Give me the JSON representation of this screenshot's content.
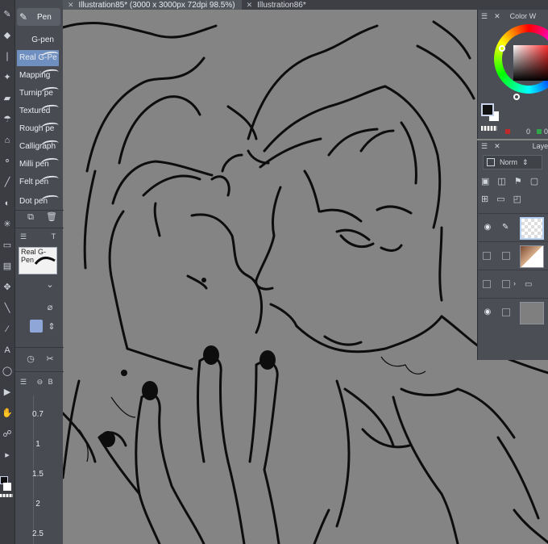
{
  "tabs": [
    {
      "label": "Illustration85* (3000 x 3000px 72dpi 98.5%)",
      "active": true
    },
    {
      "label": "Illustration86*",
      "active": false
    }
  ],
  "subtool": {
    "group_label": "Pen",
    "brushes": [
      {
        "label": "G-pen",
        "selected": false
      },
      {
        "label": "Real G-Pe",
        "selected": true
      },
      {
        "label": "Mapping",
        "selected": false
      },
      {
        "label": "Turnip pe",
        "selected": false
      },
      {
        "label": "Textured",
        "selected": false
      },
      {
        "label": "Rough pe",
        "selected": false
      },
      {
        "label": "Calligraph",
        "selected": false
      },
      {
        "label": "Milli pen",
        "selected": false
      },
      {
        "label": "Felt pen",
        "selected": false
      },
      {
        "label": "Dot pen",
        "selected": false
      }
    ],
    "property_label": "T",
    "preview_label": "Real G-Pen",
    "size_header_label": "B",
    "brush_sizes": [
      "0.7",
      "1",
      "1.5",
      "2",
      "2.5"
    ]
  },
  "color_panel": {
    "title": "Color W",
    "main_color": "#111111",
    "sub_color": "#ffffff",
    "rgb_values": [
      "0",
      "0"
    ]
  },
  "layer_panel": {
    "title": "Laye",
    "blend_mode": "Norm",
    "layers": [
      {
        "kind": "raster",
        "visible": true,
        "selected": true,
        "thumb": "transparent"
      },
      {
        "kind": "raster",
        "visible": false,
        "selected": false,
        "thumb": "sketch"
      },
      {
        "kind": "folder",
        "visible": false,
        "selected": false,
        "thumb": "folder"
      },
      {
        "kind": "paper",
        "visible": true,
        "selected": false,
        "thumb": "gray"
      }
    ]
  },
  "colors": {
    "canvas": "#848485",
    "panel": "#4b4e54",
    "selection": "#6e8fc0"
  }
}
